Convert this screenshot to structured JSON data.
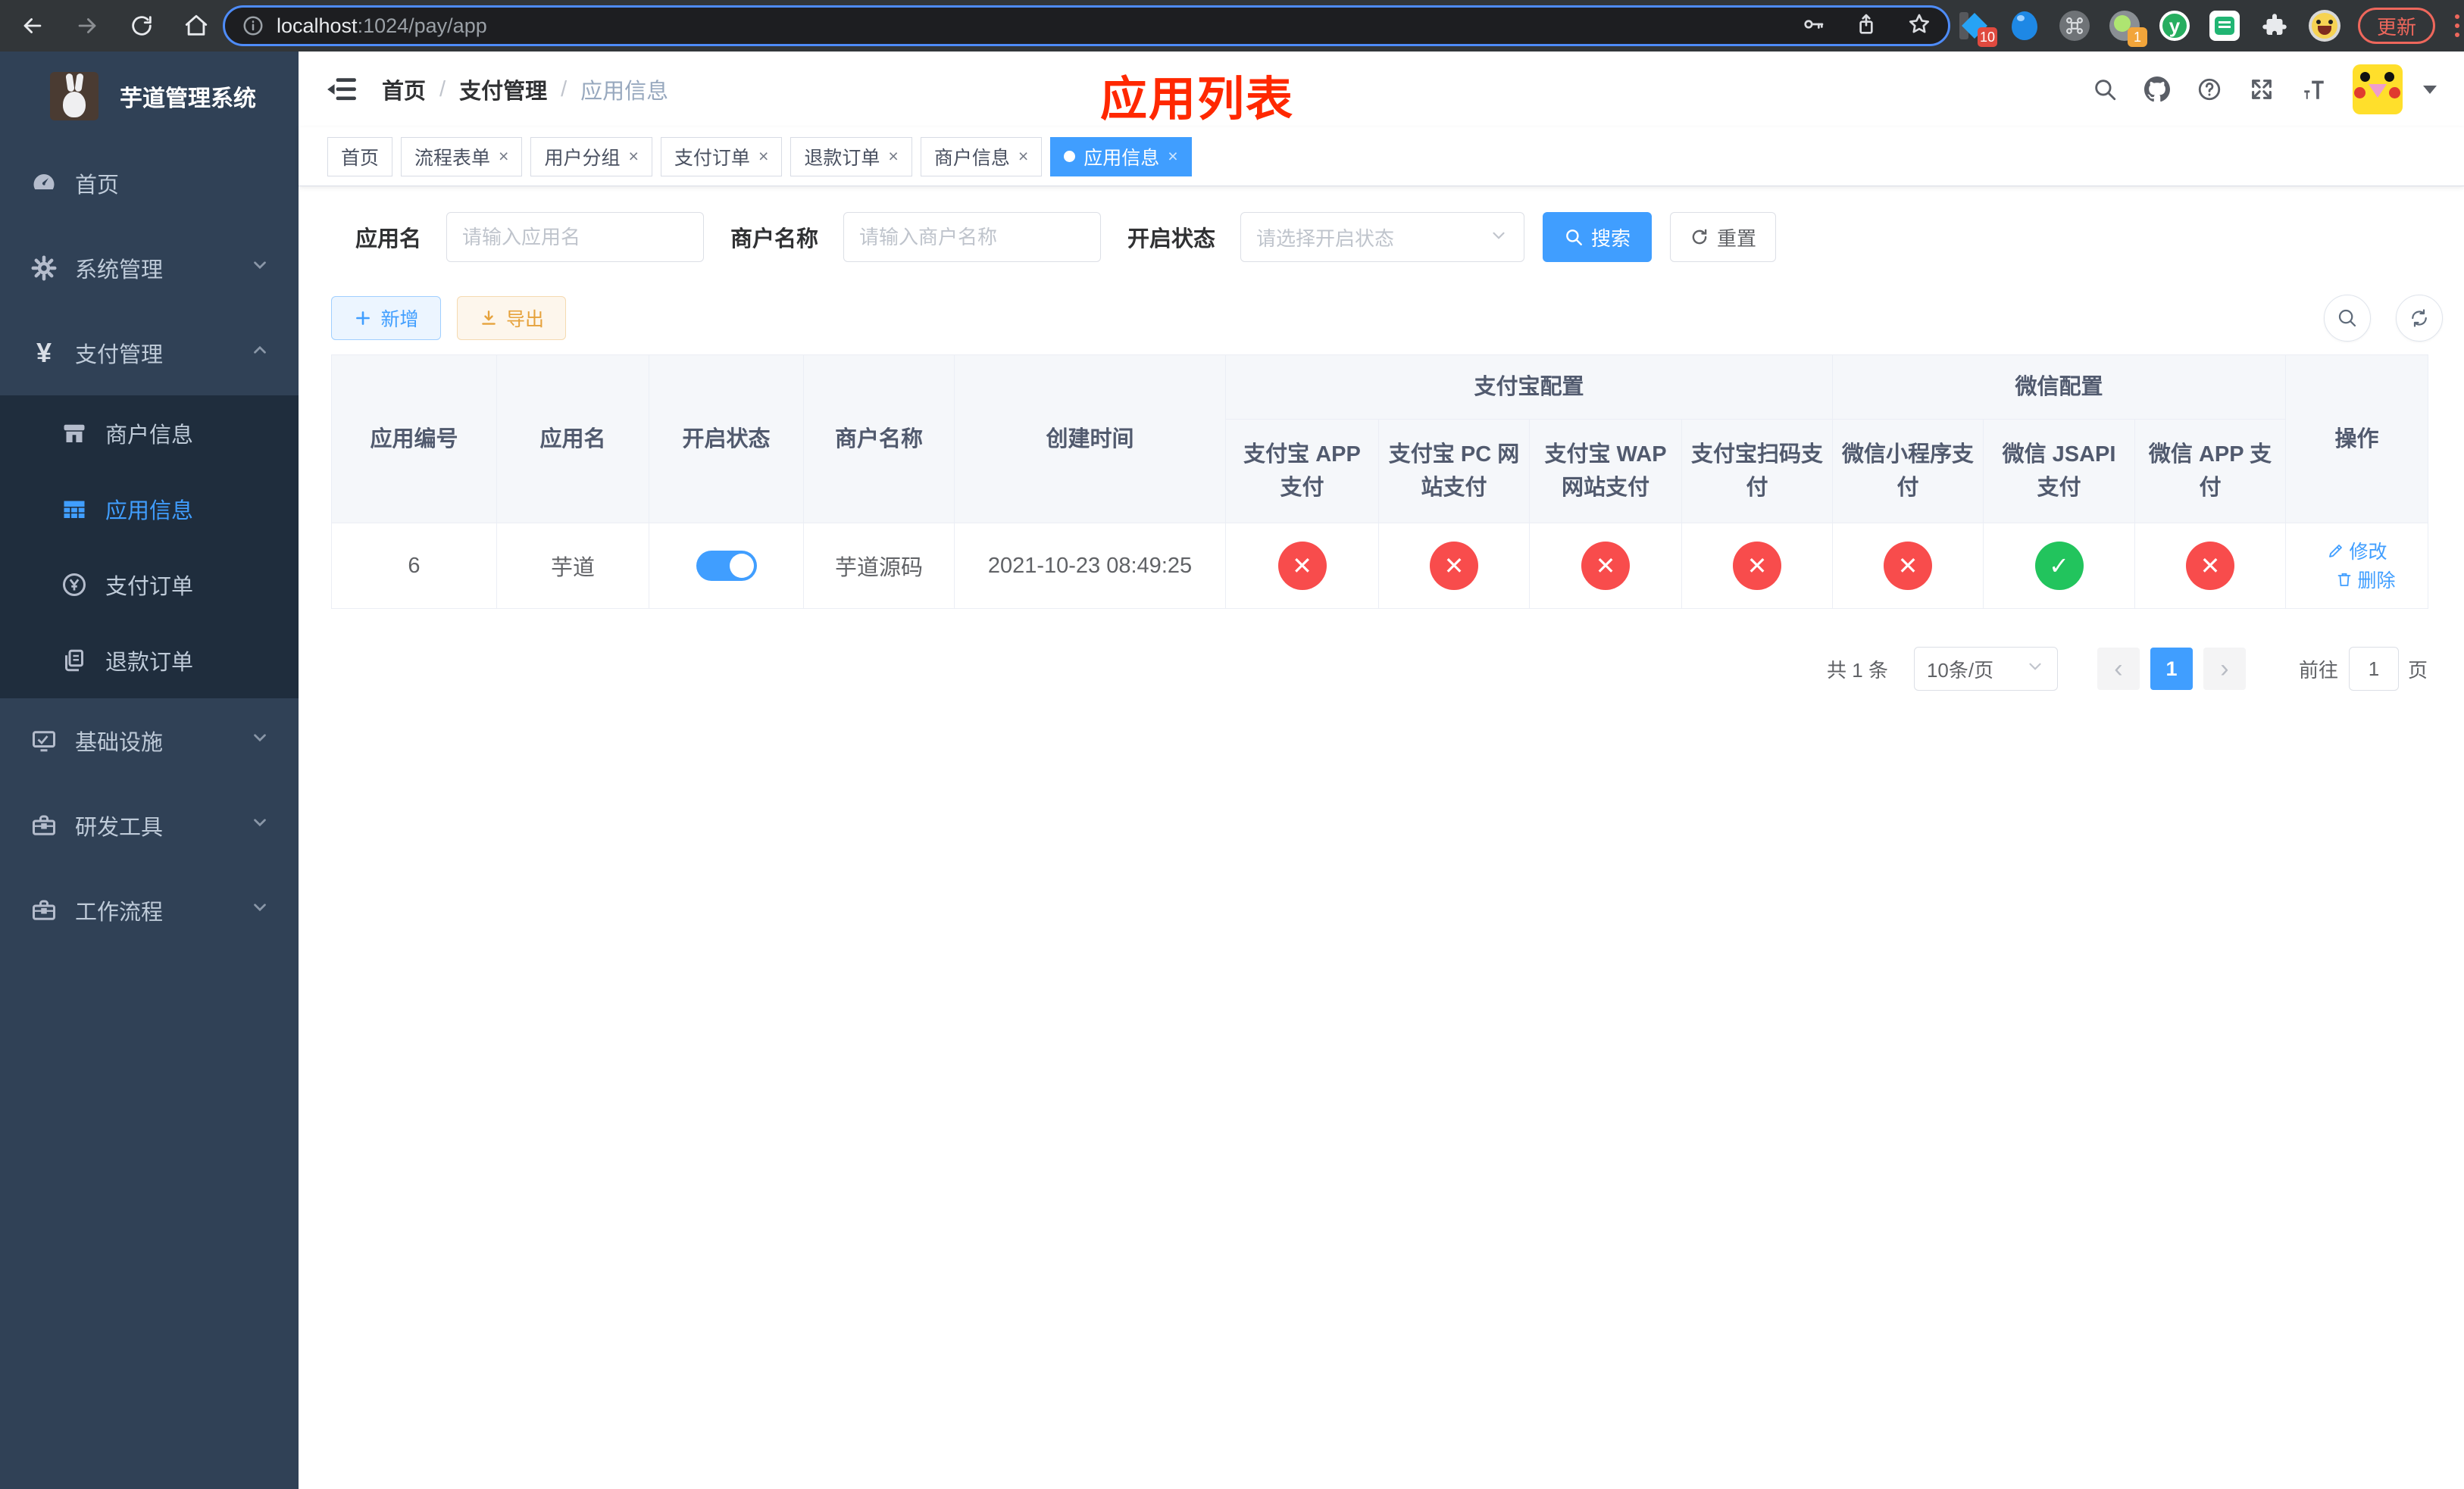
{
  "colors": {
    "accent": "#409eff",
    "danger": "#f84c4c",
    "success": "#22c45d",
    "annotation_red": "#ff2800",
    "sidebar_bg": "#304156",
    "submenu_bg": "#1f2d3d"
  },
  "glyphs": {
    "close": "×",
    "check": "✓",
    "cross": "✕",
    "yen": "¥",
    "prev": "‹",
    "next": "›",
    "command": "⌘",
    "y_letter": "y"
  },
  "browser": {
    "url_host": "localhost",
    "url_path": ":1024/pay/app",
    "ext_badge_a": "10",
    "ext_badge_b": "1",
    "update_label": "更新"
  },
  "sidebar": {
    "title": "芋道管理系统",
    "items": [
      {
        "label": "首页"
      },
      {
        "label": "系统管理"
      },
      {
        "label": "支付管理"
      },
      {
        "label": "商户信息"
      },
      {
        "label": "应用信息"
      },
      {
        "label": "支付订单"
      },
      {
        "label": "退款订单"
      },
      {
        "label": "基础设施"
      },
      {
        "label": "研发工具"
      },
      {
        "label": "工作流程"
      }
    ]
  },
  "header": {
    "breadcrumb": [
      {
        "label": "首页"
      },
      {
        "label": "支付管理"
      },
      {
        "label": "应用信息"
      }
    ],
    "separator": "/",
    "annotation": "应用列表"
  },
  "tabs": [
    {
      "label": "首页"
    },
    {
      "label": "流程表单"
    },
    {
      "label": "用户分组"
    },
    {
      "label": "支付订单"
    },
    {
      "label": "退款订单"
    },
    {
      "label": "商户信息"
    },
    {
      "label": "应用信息"
    }
  ],
  "filters": {
    "app_name_label": "应用名",
    "app_name_placeholder": "请输入应用名",
    "merchant_label": "商户名称",
    "merchant_placeholder": "请输入商户名称",
    "status_label": "开启状态",
    "status_placeholder": "请选择开启状态",
    "search_label": "搜索",
    "reset_label": "重置"
  },
  "toolbar": {
    "add_label": "新增",
    "export_label": "导出"
  },
  "table": {
    "group_alipay": "支付宝配置",
    "group_wechat": "微信配置",
    "columns": [
      "应用编号",
      "应用名",
      "开启状态",
      "商户名称",
      "创建时间",
      "支付宝 APP 支付",
      "支付宝 PC 网站支付",
      "支付宝 WAP 网站支付",
      "支付宝扫码支付",
      "微信小程序支付",
      "微信 JSAPI 支付",
      "微信 APP 支付",
      "操作"
    ],
    "row": {
      "id": "6",
      "name": "芋道",
      "enabled": true,
      "merchant": "芋道源码",
      "created": "2021-10-23 08:49:25",
      "configs": [
        false,
        false,
        false,
        false,
        false,
        true,
        false
      ],
      "edit_label": "修改",
      "delete_label": "删除"
    }
  },
  "pagination": {
    "total": "共 1 条",
    "page_size": "10条/页",
    "page": "1",
    "goto_label": "前往",
    "goto_value": "1",
    "page_unit": "页"
  }
}
